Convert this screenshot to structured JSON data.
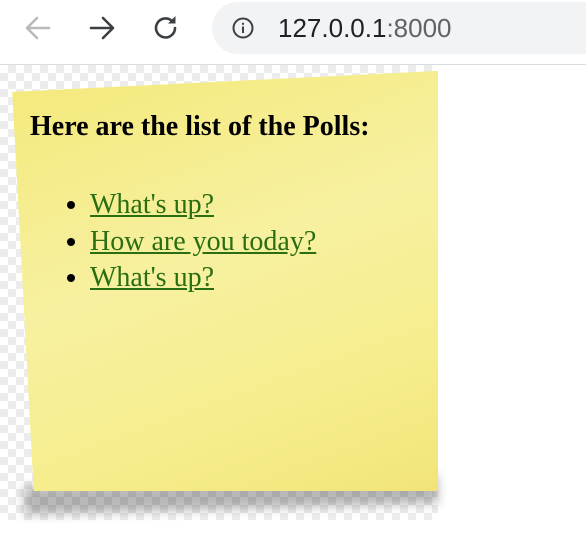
{
  "browser": {
    "url_host": "127.0.0.1",
    "url_port": ":8000",
    "icons": {
      "back": "arrow-left-icon",
      "forward": "arrow-right-icon",
      "reload": "reload-icon",
      "site_info": "info-icon"
    }
  },
  "page": {
    "heading": "Here are the list of the Polls:",
    "polls": [
      {
        "label": "What's up?"
      },
      {
        "label": "How are you today?"
      },
      {
        "label": "What's up?"
      }
    ]
  },
  "colors": {
    "note": "#f5ec85",
    "link": "#2a6e12"
  }
}
